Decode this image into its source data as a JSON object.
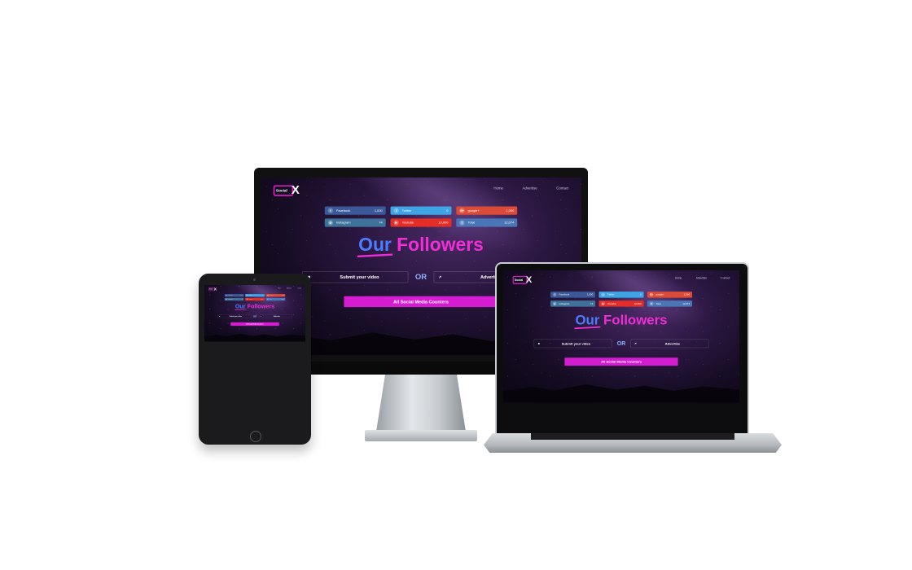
{
  "site": {
    "logo": {
      "text": "Social",
      "mark": "X"
    },
    "nav": [
      "Home",
      "Advertise",
      "Contact"
    ],
    "counters": [
      {
        "icon": "f",
        "label": "Facebook",
        "value": "1,000",
        "color": "#3b5998"
      },
      {
        "icon": "t",
        "label": "Twitter",
        "value": "0",
        "color": "#3fa4e6"
      },
      {
        "icon": "G+",
        "label": "google+",
        "value": "1,000",
        "color": "#dc4a38"
      },
      {
        "icon": "◎",
        "label": "Instagram",
        "value": "74",
        "color": "#3f729b"
      },
      {
        "icon": "▶",
        "label": "Youtube",
        "value": "10,000",
        "color": "#e52d27"
      },
      {
        "icon": "Σ",
        "label": "Total",
        "value": "12,074",
        "color": "#4a76b8"
      }
    ],
    "heading": {
      "our": "Our",
      "rest": " Followers"
    },
    "submit_label": "Submit your video",
    "or_label": "OR",
    "advertise_label": "Advertise",
    "cta_label": "All Social Media Counters"
  }
}
